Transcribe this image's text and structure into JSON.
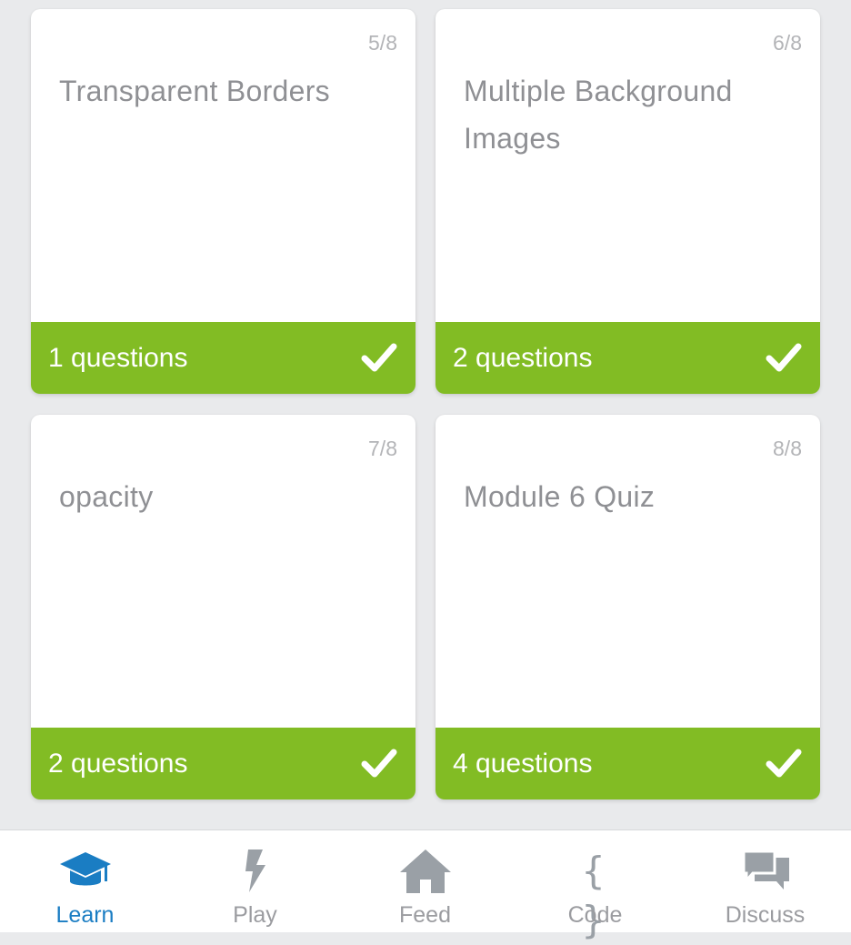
{
  "cards": [
    {
      "progress": "5/8",
      "title": "Transparent Borders",
      "questions": "1 questions",
      "completed": true
    },
    {
      "progress": "6/8",
      "title": "Multiple Background Images",
      "questions": "2 questions",
      "completed": true
    },
    {
      "progress": "7/8",
      "title": "opacity",
      "questions": "2 questions",
      "completed": true
    },
    {
      "progress": "8/8",
      "title": "Module 6 Quiz",
      "questions": "4 questions",
      "completed": true
    }
  ],
  "tabbar": {
    "active": "Learn",
    "tabs": [
      {
        "label": "Learn",
        "icon": "graduation-cap-icon"
      },
      {
        "label": "Play",
        "icon": "lightning-bolt-icon"
      },
      {
        "label": "Feed",
        "icon": "home-icon"
      },
      {
        "label": "Code",
        "icon": "curly-braces-icon",
        "glyph": "{ }"
      },
      {
        "label": "Discuss",
        "icon": "chat-bubbles-icon"
      }
    ]
  },
  "colors": {
    "accent_green": "#82bc24",
    "active_blue": "#1a7dc3",
    "inactive_gray": "#9b9ca0",
    "background": "#e9eaec"
  }
}
